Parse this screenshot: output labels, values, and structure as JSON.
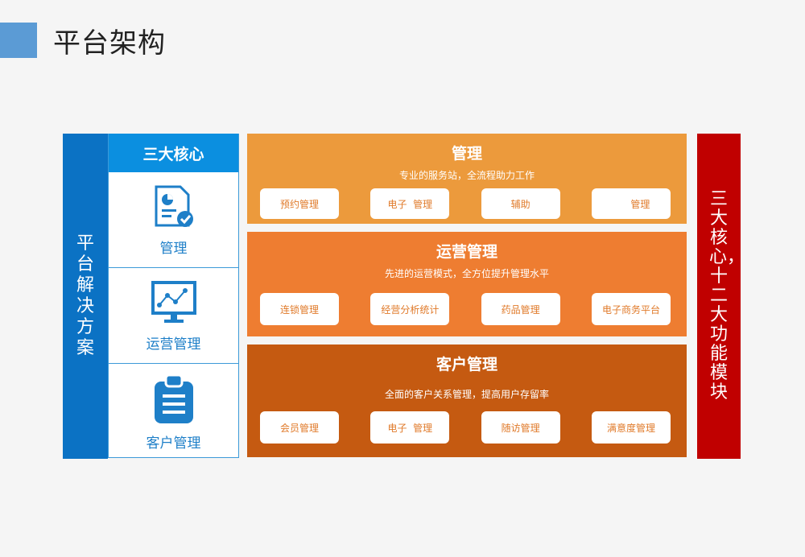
{
  "page": {
    "title": "平台架构"
  },
  "left_bar": {
    "label": "平台解决方案"
  },
  "core": {
    "header": "三大核心",
    "items": [
      {
        "label": "管理",
        "icon": "document-chart-icon"
      },
      {
        "label": "运营管理",
        "icon": "monitor-chart-icon"
      },
      {
        "label": "客户管理",
        "icon": "clipboard-list-icon"
      }
    ]
  },
  "bands": [
    {
      "title": "管理",
      "subtitle": "专业的服务站，全流程助力工作",
      "buttons": [
        "预约管理",
        "电子  管理",
        "辅助",
        "      管理"
      ]
    },
    {
      "title": "运营管理",
      "subtitle": "先进的运营模式，全方位提升管理水平",
      "buttons": [
        "连锁管理",
        "经营分析统计",
        "药品管理",
        "电子商务平台"
      ]
    },
    {
      "title": "客户管理",
      "subtitle": "全面的客户关系管理，提高用户存留率",
      "buttons": [
        "会员管理",
        "电子  管理",
        "随访管理",
        "满意度管理"
      ]
    }
  ],
  "right_bar": {
    "label": "三大核心，十二大功能模块"
  },
  "colors": {
    "accent_blue": "#0b72c4",
    "header_blue": "#0b8fe0",
    "band1": "#ec9a3c",
    "band2": "#ee7d31",
    "band3": "#c55a11",
    "right_red": "#c00000"
  }
}
